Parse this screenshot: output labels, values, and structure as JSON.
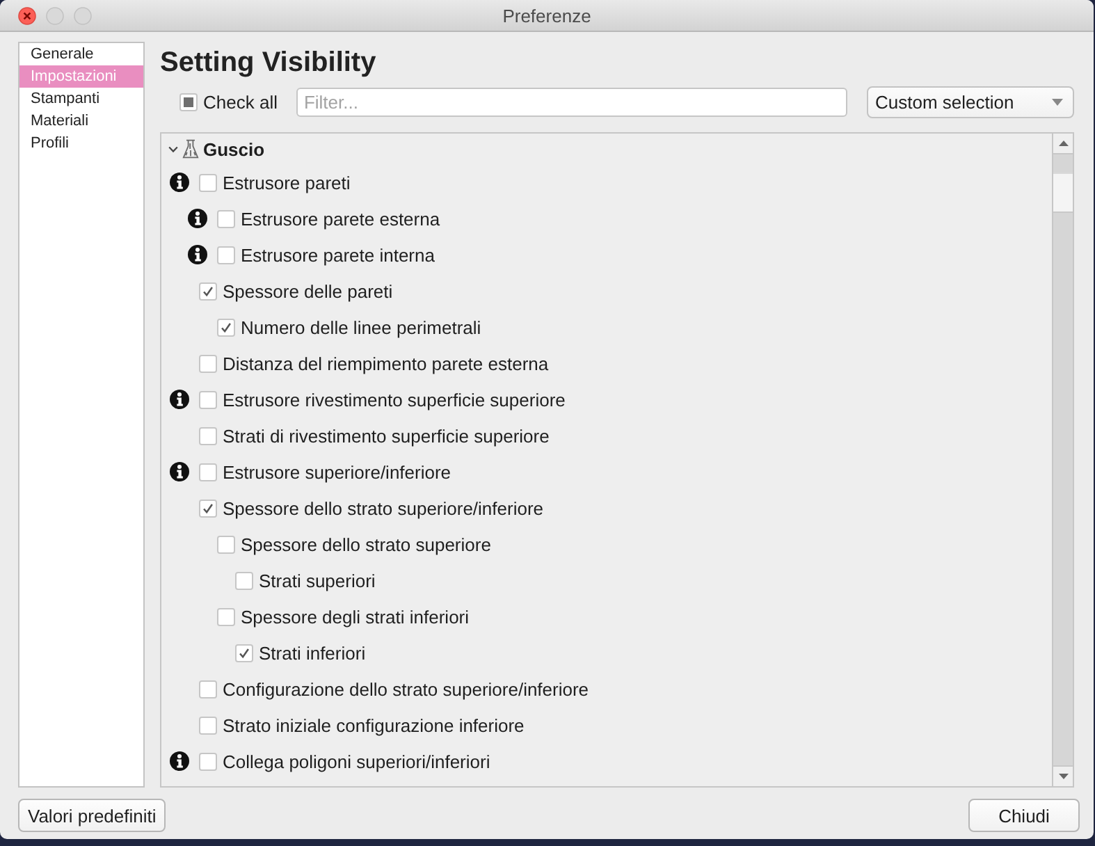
{
  "window": {
    "title": "Preferenze"
  },
  "sidebar": {
    "items": [
      {
        "label": "Generale",
        "selected": false
      },
      {
        "label": "Impostazioni",
        "selected": true
      },
      {
        "label": "Stampanti",
        "selected": false
      },
      {
        "label": "Materiali",
        "selected": false
      },
      {
        "label": "Profili",
        "selected": false
      }
    ]
  },
  "heading": "Setting Visibility",
  "check_all": {
    "label": "Check all",
    "checked": false,
    "indeterminate": true
  },
  "filter": {
    "placeholder": "Filter..."
  },
  "preset_dropdown": {
    "value": "Custom selection"
  },
  "settings_tree": {
    "label": "Guscio",
    "expanded": true,
    "children": [
      {
        "label": "Estrusore pareti",
        "info": true,
        "checked": false,
        "children": [
          {
            "label": "Estrusore parete esterna",
            "info": true,
            "checked": false
          },
          {
            "label": "Estrusore parete interna",
            "info": true,
            "checked": false
          }
        ]
      },
      {
        "label": "Spessore delle pareti",
        "info": false,
        "checked": true,
        "children": [
          {
            "label": "Numero delle linee perimetrali",
            "info": false,
            "checked": true
          }
        ]
      },
      {
        "label": "Distanza del riempimento parete esterna",
        "info": false,
        "checked": false
      },
      {
        "label": "Estrusore rivestimento superficie superiore",
        "info": true,
        "checked": false
      },
      {
        "label": "Strati di rivestimento superficie superiore",
        "info": false,
        "checked": false
      },
      {
        "label": "Estrusore superiore/inferiore",
        "info": true,
        "checked": false
      },
      {
        "label": "Spessore dello strato superiore/inferiore",
        "info": false,
        "checked": true,
        "children": [
          {
            "label": "Spessore dello strato superiore",
            "info": false,
            "checked": false,
            "children": [
              {
                "label": "Strati superiori",
                "info": false,
                "checked": false
              }
            ]
          },
          {
            "label": "Spessore degli strati inferiori",
            "info": false,
            "checked": false,
            "children": [
              {
                "label": "Strati inferiori",
                "info": false,
                "checked": true
              }
            ]
          }
        ]
      },
      {
        "label": "Configurazione dello strato superiore/inferiore",
        "info": false,
        "checked": false
      },
      {
        "label": "Strato iniziale configurazione inferiore",
        "info": false,
        "checked": false
      },
      {
        "label": "Collega poligoni superiori/inferiori",
        "info": true,
        "checked": false
      }
    ]
  },
  "footer": {
    "defaults_button": "Valori predefiniti",
    "close_button": "Chiudi"
  }
}
